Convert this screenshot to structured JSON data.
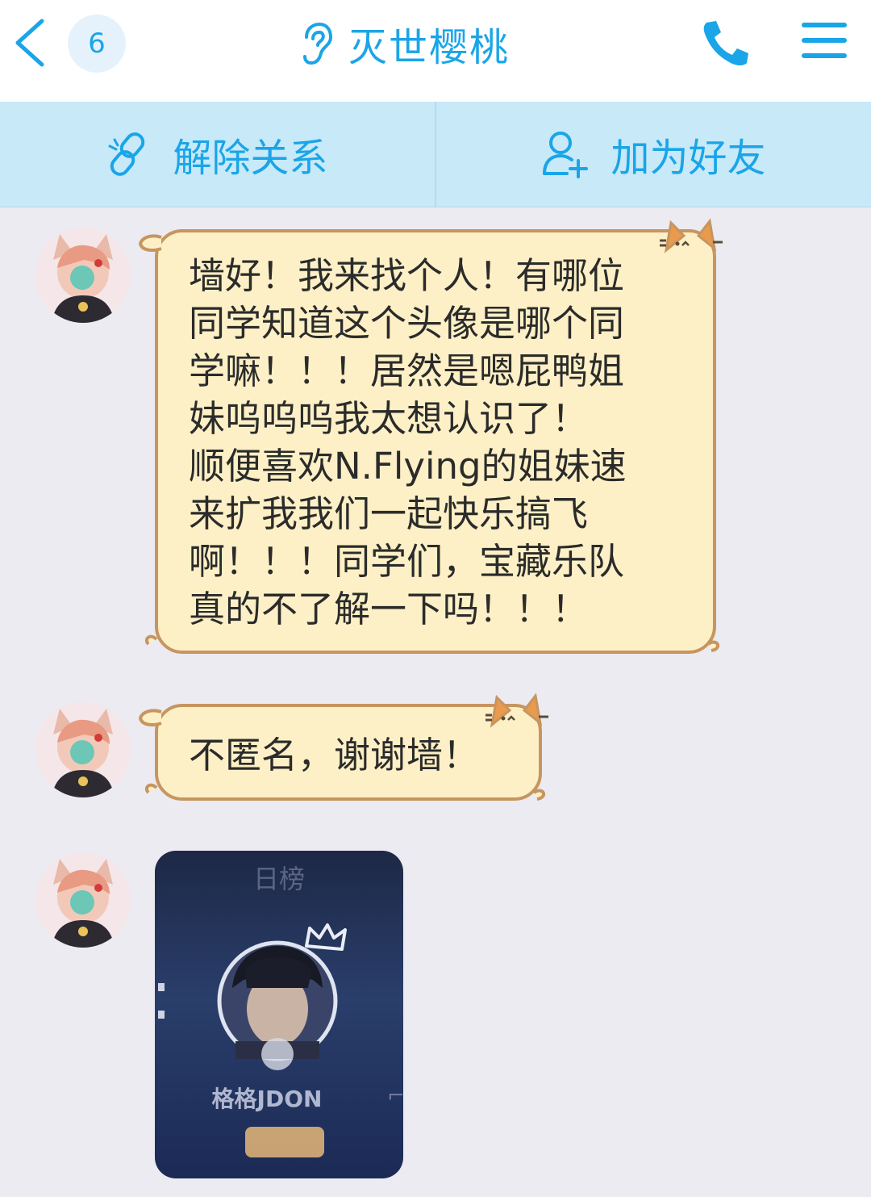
{
  "header": {
    "unread_count": "6",
    "title": "灭世樱桃",
    "back_icon": "chevron-left-icon",
    "ear_icon": "ear-icon",
    "phone_icon": "phone-icon",
    "menu_icon": "menu-icon",
    "accent_color": "#1aa5e8"
  },
  "actions": [
    {
      "label": "解除关系",
      "icon": "unlink-icon"
    },
    {
      "label": "加为好友",
      "icon": "add-friend-icon"
    }
  ],
  "messages": [
    {
      "type": "text",
      "text": "墙好！我来找个人！有哪位\n同学知道这个头像是哪个同\n学嘛！！！居然是嗯屁鸭姐\n妹呜呜呜我太想认识了！\n顺便喜欢N.Flying的姐妹速\n来扩我我们一起快乐搞飞\n啊！！！同学们，宝藏乐队\n真的不了解一下吗！！！"
    },
    {
      "type": "text",
      "text": "不匿名，谢谢墙！"
    },
    {
      "type": "image",
      "top_label": "日榜",
      "name_label": "格格JDON"
    }
  ]
}
